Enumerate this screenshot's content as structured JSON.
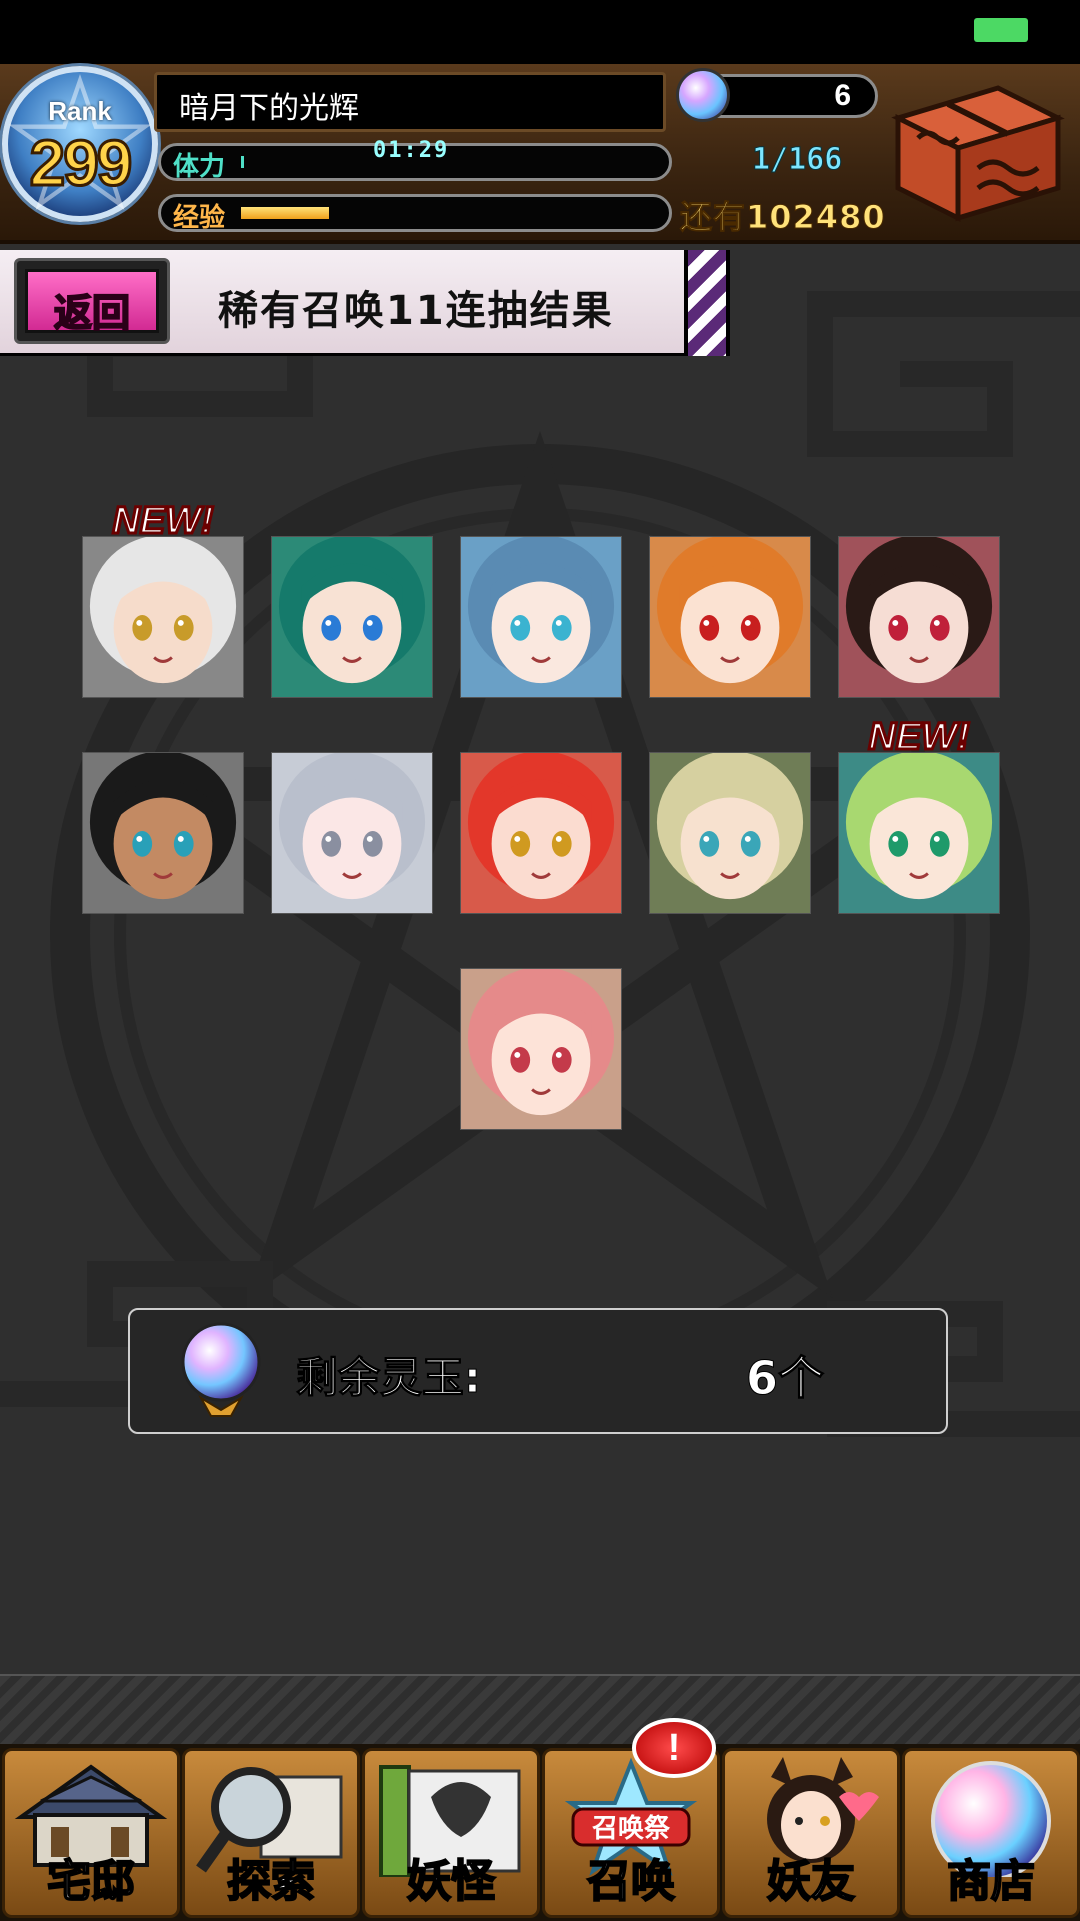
{
  "status_bar": {
    "battery_color": "#4cd964"
  },
  "header": {
    "rank_label": "Rank",
    "rank_value": "299",
    "player_name": "暗月下的光辉",
    "stamina_label": "体力",
    "stamina_timer": "01:29",
    "stamina_fraction": 0.006,
    "exp_label": "经验",
    "exp_fraction": 0.2,
    "orb_count": "6",
    "box_count": "1/166",
    "exp_remaining": "还有102480"
  },
  "banner": {
    "back_label": "返回",
    "title": "稀有召唤11连抽结果"
  },
  "results": [
    {
      "hair": "#e6e6e6",
      "skin": "#f6dccb",
      "eyes": "#c89b2a",
      "bg": "#888888",
      "new": true
    },
    {
      "hair": "#157a6b",
      "skin": "#f8e2d4",
      "eyes": "#2a7bd6",
      "bg": "#2c8a77",
      "new": false
    },
    {
      "hair": "#5a8bb3",
      "skin": "#fae8df",
      "eyes": "#3bb3d0",
      "bg": "#6aa0c6",
      "new": false
    },
    {
      "hair": "#e07b2a",
      "skin": "#fbe2d2",
      "eyes": "#c81f1f",
      "bg": "#d88a4a",
      "new": false
    },
    {
      "hair": "#2a1a16",
      "skin": "#f6ddd4",
      "eyes": "#c0203a",
      "bg": "#a0525a",
      "new": false
    },
    {
      "hair": "#1a1a1a",
      "skin": "#c38a63",
      "eyes": "#29a0b8",
      "bg": "#777777",
      "new": false
    },
    {
      "hair": "#b9bfcc",
      "skin": "#fbe7e6",
      "eyes": "#8a8fa0",
      "bg": "#c7ccd6",
      "new": false
    },
    {
      "hair": "#e3372a",
      "skin": "#fbdcd0",
      "eyes": "#d09a20",
      "bg": "#d85a4a",
      "new": false
    },
    {
      "hair": "#d6d0a0",
      "skin": "#f7e1cf",
      "eyes": "#3aa6b8",
      "bg": "#6f7d56",
      "new": false
    },
    {
      "hair": "#a8d870",
      "skin": "#fae6d8",
      "eyes": "#1e9a6a",
      "bg": "#3d8b86",
      "new": true
    },
    {
      "hair": "#e58a8a",
      "skin": "#fde3d8",
      "eyes": "#c43a4a",
      "bg": "#c9a08a",
      "new": false
    }
  ],
  "new_tag": "NEW!",
  "remaining": {
    "label": "剩余灵玉:",
    "value": "6个"
  },
  "nav": {
    "items": [
      {
        "label": "宅邸",
        "icon": "mansion-icon"
      },
      {
        "label": "探索",
        "icon": "magnifier-map-icon"
      },
      {
        "label": "妖怪",
        "icon": "scroll-monster-icon"
      },
      {
        "label": "召唤",
        "icon": "summon-festival-icon",
        "banner": "召唤祭"
      },
      {
        "label": "妖友",
        "icon": "fox-girl-icon"
      },
      {
        "label": "商店",
        "icon": "orb-shop-icon"
      }
    ],
    "alert_badge": "!"
  }
}
